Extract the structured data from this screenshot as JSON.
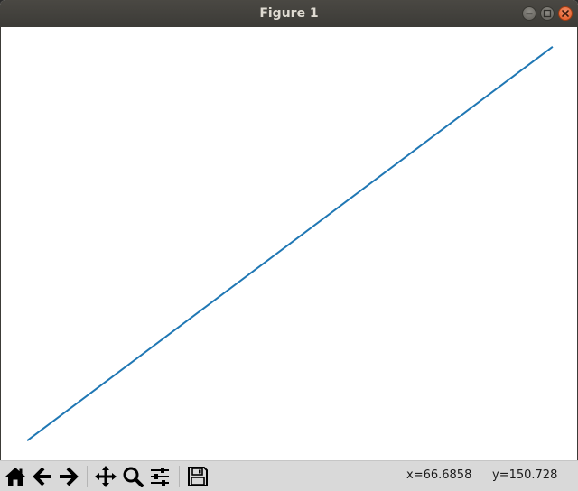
{
  "window": {
    "title": "Figure 1"
  },
  "chart_data": {
    "type": "line",
    "title": "",
    "xlabel": "",
    "ylabel": "",
    "grid": false,
    "axes_visible": false,
    "series": [
      {
        "color": "#1f77b4",
        "x": [
          0,
          99
        ],
        "y": [
          0,
          198
        ]
      }
    ],
    "xlim": [
      -4.95,
      103.95
    ],
    "ylim": [
      -9.9,
      207.9
    ]
  },
  "toolbar": {
    "buttons": [
      {
        "icon": "home-icon",
        "tooltip": "Reset original view"
      },
      {
        "icon": "back-arrow-icon",
        "tooltip": "Back to previous view"
      },
      {
        "icon": "forward-arrow-icon",
        "tooltip": "Forward to next view"
      },
      {
        "icon": "pan-icon",
        "tooltip": "Pan axes"
      },
      {
        "icon": "zoom-icon",
        "tooltip": "Zoom to rectangle"
      },
      {
        "icon": "configure-subplots-icon",
        "tooltip": "Configure subplots"
      },
      {
        "icon": "save-icon",
        "tooltip": "Save the figure"
      }
    ],
    "coord_x": "x=66.6858",
    "coord_y": "y=150.728"
  },
  "colors": {
    "titlebar": "#3c3b37",
    "close_button": "#e2561f",
    "line": "#1f77b4",
    "toolbar_bg": "#d9d9d9"
  }
}
